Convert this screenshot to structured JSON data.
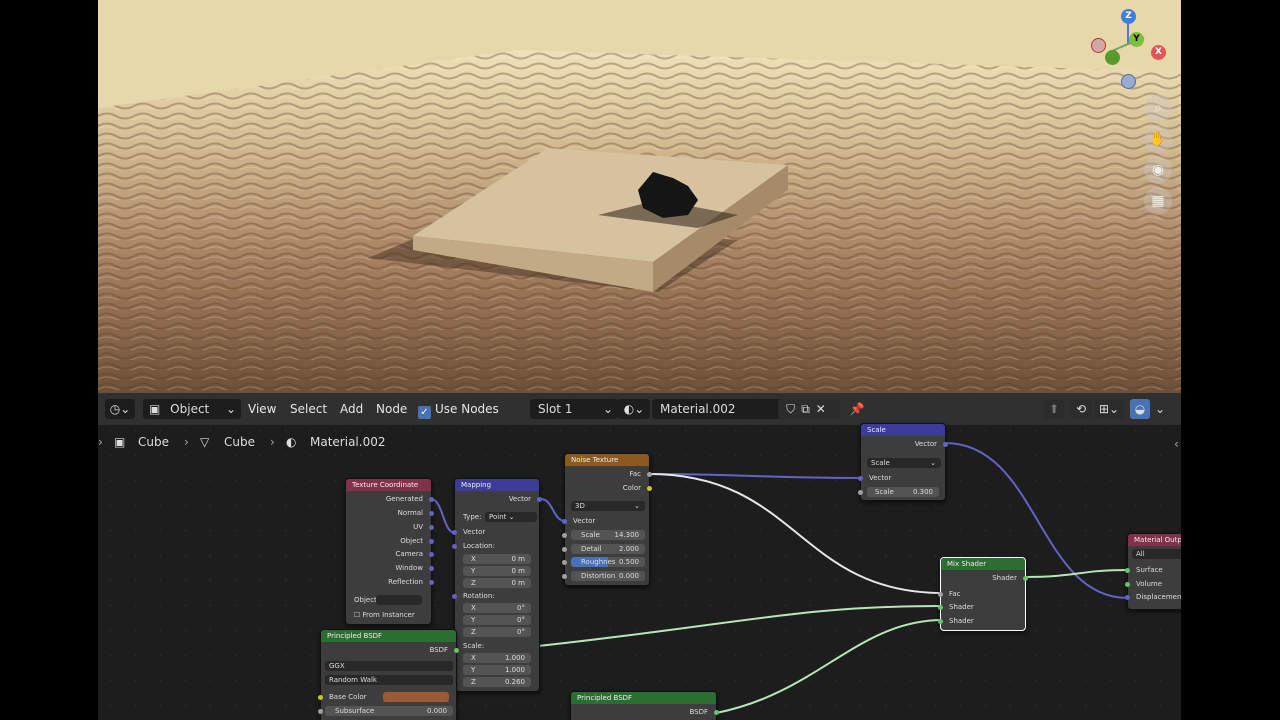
{
  "viewport": {
    "gizmo": {
      "z": "Z",
      "y": "Y",
      "x": "X"
    },
    "nav_icons": [
      "zoom-icon",
      "hand-icon",
      "camera-icon",
      "grid-icon"
    ]
  },
  "header": {
    "mode": "Object",
    "menus": [
      "View",
      "Select",
      "Add",
      "Node"
    ],
    "use_nodes_label": "Use Nodes",
    "slot": "Slot 1",
    "material_name": "Material.002"
  },
  "breadcrumb": {
    "object": "Cube",
    "mesh": "Cube",
    "material": "Material.002"
  },
  "nodes": {
    "texcoord": {
      "title": "Texture Coordinate",
      "outputs": [
        "Generated",
        "Normal",
        "UV",
        "Object",
        "Camera",
        "Window",
        "Reflection"
      ],
      "object_label": "Object:",
      "from_instancer": "From Instancer"
    },
    "mapping": {
      "title": "Mapping",
      "output": "Vector",
      "type_label": "Type:",
      "type_value": "Point",
      "vector_in": "Vector",
      "location": "Location:",
      "loc": [
        {
          "a": "X",
          "v": "0 m"
        },
        {
          "a": "Y",
          "v": "0 m"
        },
        {
          "a": "Z",
          "v": "0 m"
        }
      ],
      "rotation": "Rotation:",
      "rot": [
        {
          "a": "X",
          "v": "0°"
        },
        {
          "a": "Y",
          "v": "0°"
        },
        {
          "a": "Z",
          "v": "0°"
        }
      ],
      "scale": "Scale:",
      "sca": [
        {
          "a": "X",
          "v": "1.000"
        },
        {
          "a": "Y",
          "v": "1.000"
        },
        {
          "a": "Z",
          "v": "0.260"
        }
      ]
    },
    "noise": {
      "title": "Noise Texture",
      "fac": "Fac",
      "color": "Color",
      "dim": "3D",
      "vector": "Vector",
      "scale_l": "Scale",
      "scale_v": "14.300",
      "detail_l": "Detail",
      "detail_v": "2.000",
      "rough_l": "Roughnes",
      "rough_v": "0.500",
      "dist_l": "Distortion",
      "dist_v": "0.000"
    },
    "scalevec": {
      "title": "Scale",
      "output": "Vector",
      "op": "Scale",
      "vector_in": "Vector",
      "scale_l": "Scale",
      "scale_v": "0.300"
    },
    "mix": {
      "title": "Mix Shader",
      "out": "Shader",
      "fac": "Fac",
      "shader1": "Shader",
      "shader2": "Shader"
    },
    "output": {
      "title": "Material Outp",
      "target": "All",
      "surface": "Surface",
      "volume": "Volume",
      "displacement": "Displacement"
    },
    "bsdf1": {
      "title": "Principled BSDF",
      "out": "BSDF",
      "dist": "GGX",
      "sss": "Random Walk",
      "base_color": "Base Color",
      "subsurface_l": "Subsurface",
      "subsurface_v": "0.000"
    },
    "bsdf2": {
      "title": "Principled BSDF",
      "out": "BSDF"
    }
  },
  "colors": {
    "header_input": "#83314a",
    "header_vector": "#3b3b99",
    "header_texture": "#8c5a1e",
    "header_shader": "#2b6e32",
    "base_color": "#9a5a36"
  }
}
